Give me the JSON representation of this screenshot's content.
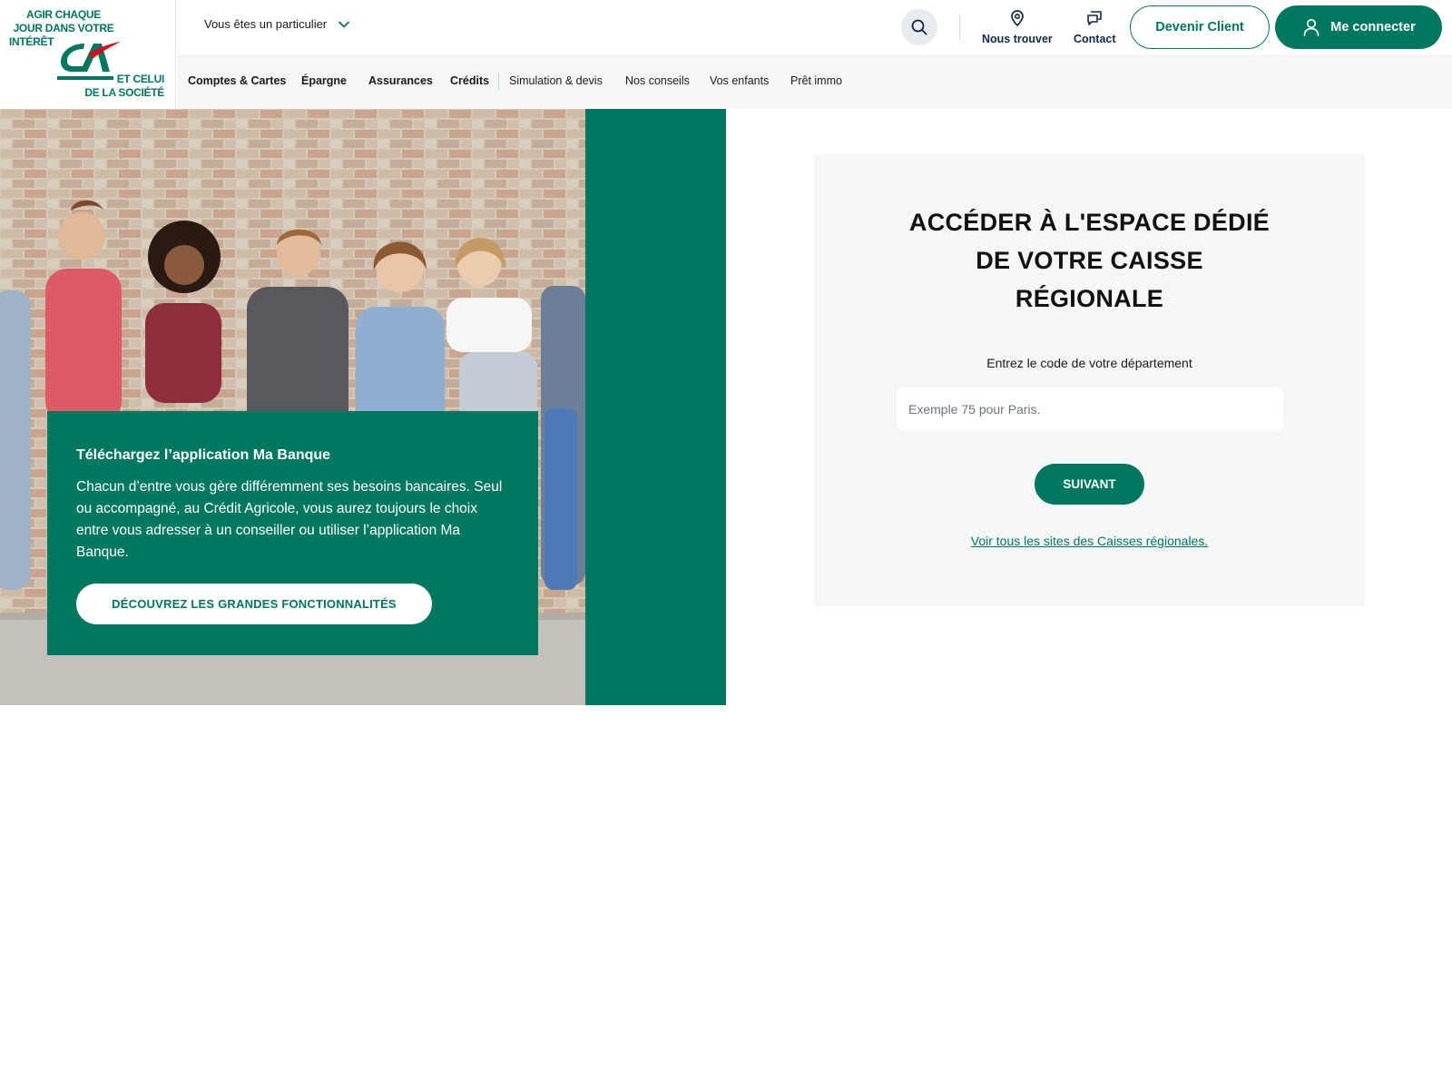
{
  "brand": {
    "tagline_top": [
      "AGIR CHAQUE",
      "JOUR DANS VOTRE",
      "INTÉRÊT"
    ],
    "tagline_bottom": [
      "ET CELUI",
      "DE LA SOCIÉTÉ"
    ],
    "logo_icon": "credit-agricole-ca-logo",
    "colors": {
      "primary": "#00775f",
      "accent_red": "#e2001a",
      "nav_bg": "#f4f6f7"
    }
  },
  "header": {
    "profile_select": "Vous êtes un particulier",
    "search_icon": "search-icon",
    "nous_trouver": "Nous trouver",
    "contact": "Contact",
    "devenir_client": "Devenir Client",
    "me_connecter": "Me connecter"
  },
  "nav": {
    "items": [
      {
        "label": "Comptes & Cartes"
      },
      {
        "label": "Épargne"
      },
      {
        "label": "Assurances"
      },
      {
        "label": "Crédits"
      },
      {
        "label": "Simulation & devis"
      },
      {
        "label": "Nos conseils"
      },
      {
        "label": "Vos enfants"
      },
      {
        "label": "Prêt immo"
      }
    ]
  },
  "hero": {
    "card_title": "Téléchargez l’application Ma Banque",
    "card_text": "Chacun d’entre vous gère différemment ses besoins bancaires. Seul ou accompagné, au Crédit Agricole, vous aurez toujours le choix entre vous adresser à un conseiller ou utiliser l’application Ma Banque.",
    "card_cta": "DÉCOUVREZ LES GRANDES FONCTIONNALITÉS"
  },
  "panel": {
    "title_lines": [
      "ACCÉDER À L'ESPACE DÉDIÉ",
      "DE VOTRE CAISSE",
      "RÉGIONALE"
    ],
    "label": "Entrez le code de votre département",
    "input_placeholder": "Exemple 75 pour Paris.",
    "input_value": "",
    "submit": "SUIVANT",
    "link": "Voir tous les sites des Caisses régionales."
  }
}
